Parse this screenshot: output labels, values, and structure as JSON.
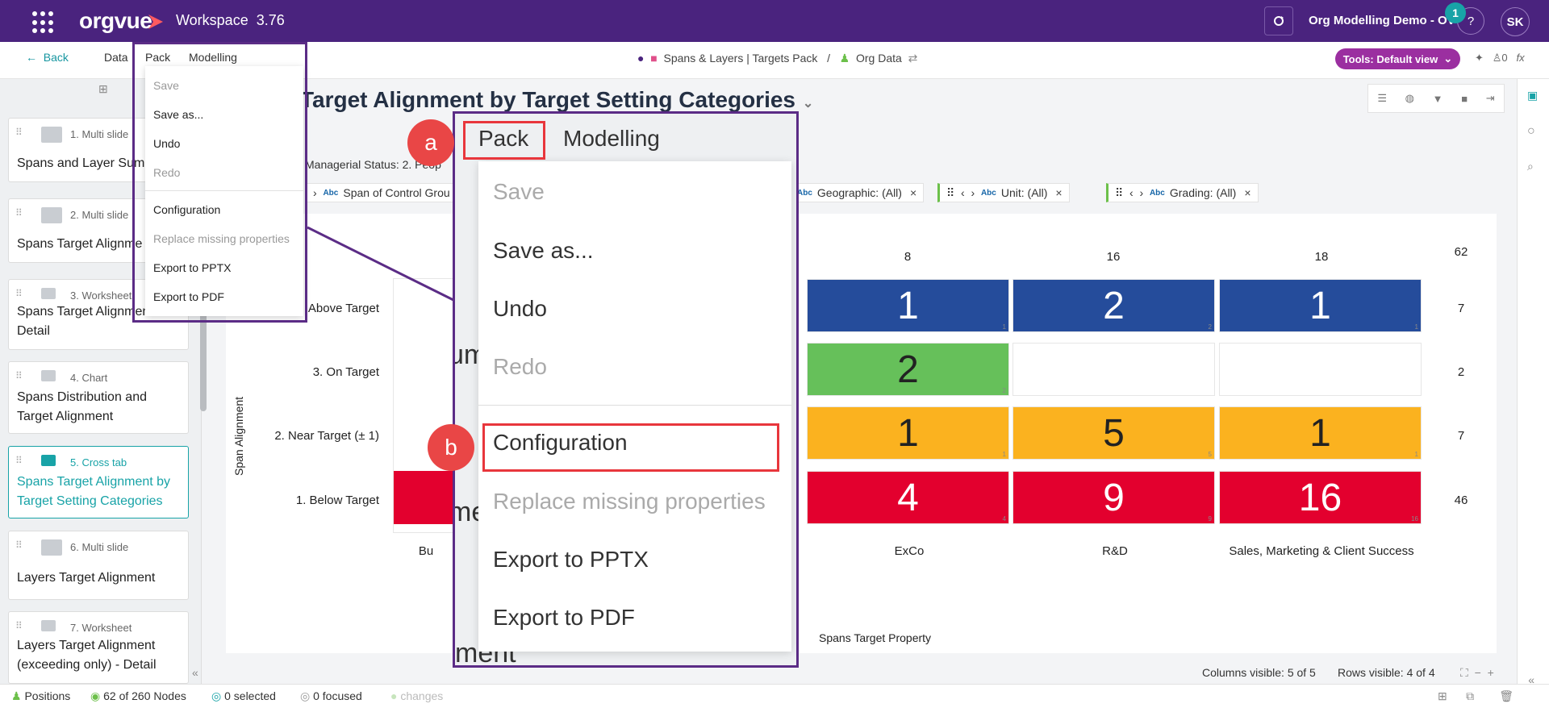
{
  "topbar": {
    "logo": "orgvue",
    "workspace": "Workspace",
    "version": "3.76",
    "demo": "Org Modelling Demo - OV",
    "help": "?",
    "notifications": "1",
    "avatar": "SK",
    "brand_color": "#4a237e"
  },
  "menubar": {
    "back": "Back",
    "items": [
      "Data",
      "Pack",
      "Modelling"
    ],
    "crumb_pack": "Spans & Layers | Targets Pack",
    "crumb_sep": "/",
    "crumb_data": "Org Data",
    "tools": "Tools: Default view",
    "pin_count": "0",
    "fx": "fx"
  },
  "dropdown": {
    "items": [
      {
        "label": "Save",
        "disabled": true
      },
      {
        "label": "Save as...",
        "disabled": false
      },
      {
        "label": "Undo",
        "disabled": false
      },
      {
        "label": "Redo",
        "disabled": true
      },
      {
        "label": "Configuration",
        "disabled": false
      },
      {
        "label": "Replace missing properties",
        "disabled": true
      },
      {
        "label": "Export to PPTX",
        "disabled": false
      },
      {
        "label": "Export to PDF",
        "disabled": false
      }
    ]
  },
  "zoom": {
    "tab_pack": "Pack",
    "tab_modelling": "Modelling",
    "badge_a": "a",
    "badge_b": "b",
    "bg_fragment_1": "um",
    "bg_fragment_2": "me",
    "bg_fragment_3": "ment"
  },
  "sidebar": {
    "items": [
      {
        "meta": "1. Multi slide",
        "title": "Spans and Layer Sum"
      },
      {
        "meta": "2. Multi slide",
        "title": "Spans Target Alignme"
      },
      {
        "meta": "3. Worksheet",
        "title": "Spans Target Alignment",
        "title2": "Detail"
      },
      {
        "meta": "4. Chart",
        "title": "Spans Distribution and",
        "title2": "Target Alignment"
      },
      {
        "meta": "5. Cross tab",
        "title": "Spans Target Alignment by",
        "title2": "Target Setting Categories",
        "active": true
      },
      {
        "meta": "6. Multi slide",
        "title": "Layers Target Alignment"
      },
      {
        "meta": "7. Worksheet",
        "title": "Layers Target Alignment",
        "title2": "(exceeding only) - Detail"
      }
    ]
  },
  "main": {
    "heading": "Target Alignment by Target Setting Categories",
    "filter_label": "Managerial Status: 2. Peop",
    "chips": [
      {
        "label": "Span of Control Grou"
      },
      {
        "label": "Geographic: (All)"
      },
      {
        "label": "Unit: (All)"
      },
      {
        "label": "Grading: (All)"
      }
    ],
    "y_axis_label": "Span Alignment",
    "x_axis_label": "Spans Target Property",
    "grand_total": "62"
  },
  "chart_data": {
    "type": "table",
    "columns": [
      "Bu",
      "ExCo",
      "R&D",
      "Sales, Marketing & Client Success"
    ],
    "column_totals": [
      "",
      "8",
      "16",
      "18"
    ],
    "rows": [
      "Above Target",
      "3. On Target",
      "2. Near Target (± 1)",
      "1. Below Target"
    ],
    "row_totals": [
      "7",
      "2",
      "7",
      "46"
    ],
    "visible_cells": [
      {
        "row": "Above Target",
        "column": "ExCo",
        "value": "1",
        "small": "1",
        "color": "#254c9b"
      },
      {
        "row": "Above Target",
        "column": "R&D",
        "value": "2",
        "small": "2",
        "color": "#254c9b"
      },
      {
        "row": "Above Target",
        "column": "Sales, Marketing & Client Success",
        "value": "1",
        "small": "1",
        "color": "#254c9b"
      },
      {
        "row": "3. On Target",
        "column": "ExCo",
        "value": "2",
        "small": "2",
        "color": "#66c05a"
      },
      {
        "row": "2. Near Target (± 1)",
        "column": "ExCo",
        "value": "1",
        "small": "1",
        "color": "#fbb21f"
      },
      {
        "row": "2. Near Target (± 1)",
        "column": "R&D",
        "value": "5",
        "small": "5",
        "color": "#fbb21f"
      },
      {
        "row": "2. Near Target (± 1)",
        "column": "Sales, Marketing & Client Success",
        "value": "1",
        "small": "1",
        "color": "#fbb21f"
      },
      {
        "row": "1. Below Target",
        "column": "ExCo",
        "value": "4",
        "small": "4",
        "color": "#e3002e"
      },
      {
        "row": "1. Below Target",
        "column": "R&D",
        "value": "9",
        "small": "9",
        "color": "#e3002e"
      },
      {
        "row": "1. Below Target",
        "column": "Sales, Marketing & Client Success",
        "value": "16",
        "small": "16",
        "color": "#e3002e"
      }
    ]
  },
  "status": {
    "positions": "Positions",
    "nodes": "62 of 260 Nodes",
    "selected": "0 selected",
    "focused": "0 focused",
    "changes": "changes",
    "columns_visible": "Columns visible: 5 of 5",
    "rows_visible": "Rows visible: 4 of 4"
  }
}
